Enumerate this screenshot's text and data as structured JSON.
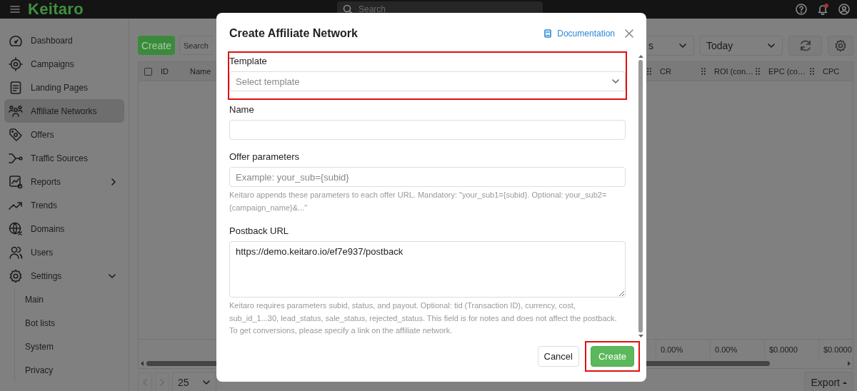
{
  "topbar": {
    "logo": "Keitaro",
    "search": {
      "placeholder": "Search"
    },
    "notifications_unread": true
  },
  "sidebar": {
    "items": [
      {
        "label": "Dashboard",
        "selected": false
      },
      {
        "label": "Campaigns",
        "selected": false
      },
      {
        "label": "Landing Pages",
        "selected": false
      },
      {
        "label": "Affiliate Networks",
        "selected": true
      },
      {
        "label": "Offers",
        "selected": false
      },
      {
        "label": "Traffic Sources",
        "selected": false
      },
      {
        "label": "Reports",
        "selected": false,
        "expanded": false
      },
      {
        "label": "Trends",
        "selected": false
      },
      {
        "label": "Domains",
        "selected": false
      },
      {
        "label": "Users",
        "selected": false
      },
      {
        "label": "Settings",
        "selected": false,
        "expanded": true,
        "children": [
          {
            "label": "Main",
            "selected": false
          },
          {
            "label": "Bot lists",
            "selected": false
          },
          {
            "label": "System",
            "selected": false
          },
          {
            "label": "Privacy",
            "selected": false
          }
        ]
      }
    ]
  },
  "toolbar": {
    "create_button": "Create",
    "search": {
      "placeholder": "Search"
    },
    "columns_dropdown": {
      "value": "s"
    },
    "period_dropdown": {
      "value": "Today"
    }
  },
  "table": {
    "header_checkbox": {
      "checked": false
    },
    "left_columns": [
      "ID",
      "Name"
    ],
    "right_columns": [
      "CR",
      "ROI (con…",
      "EPC (co…",
      "CPC"
    ],
    "totals": [
      "0.00%",
      "0.00%",
      "$0.0000",
      "$0.0000"
    ]
  },
  "pagination": {
    "page_size": "25"
  },
  "export_button": "Export",
  "dialog": {
    "title": "Create Affiliate Network",
    "documentation_link": "Documentation",
    "fields": [
      {
        "kind": "select",
        "label": "Template",
        "placeholder": "Select template",
        "highlighted": true
      },
      {
        "kind": "text",
        "label": "Name",
        "highlighted": false
      },
      {
        "kind": "text",
        "label": "Offer parameters",
        "placeholder": "Example: your_sub={subid}",
        "help": "Keitaro appends these parameters to each offer URL. Mandatory: \"your_sub1={subid}. Optional: your_sub2={campaign_name}&...\"",
        "highlighted": false
      },
      {
        "kind": "textarea",
        "label": "Postback URL",
        "value": "https://demo.keitaro.io/ef7e937/postback",
        "help": "Keitaro requires parameters subid, status, and payout. Optional: tid (Transaction ID), currency, cost, sub_id_1...30, lead_status, sale_status, rejected_status. This field is for notes and does not affect the postback. To get conversions, please specify a link on the affiliate network.",
        "highlighted": false
      }
    ],
    "buttons": [
      {
        "label": "Cancel",
        "kind": "secondary",
        "highlighted": false
      },
      {
        "label": "Create",
        "kind": "primary",
        "highlighted": true
      }
    ]
  }
}
